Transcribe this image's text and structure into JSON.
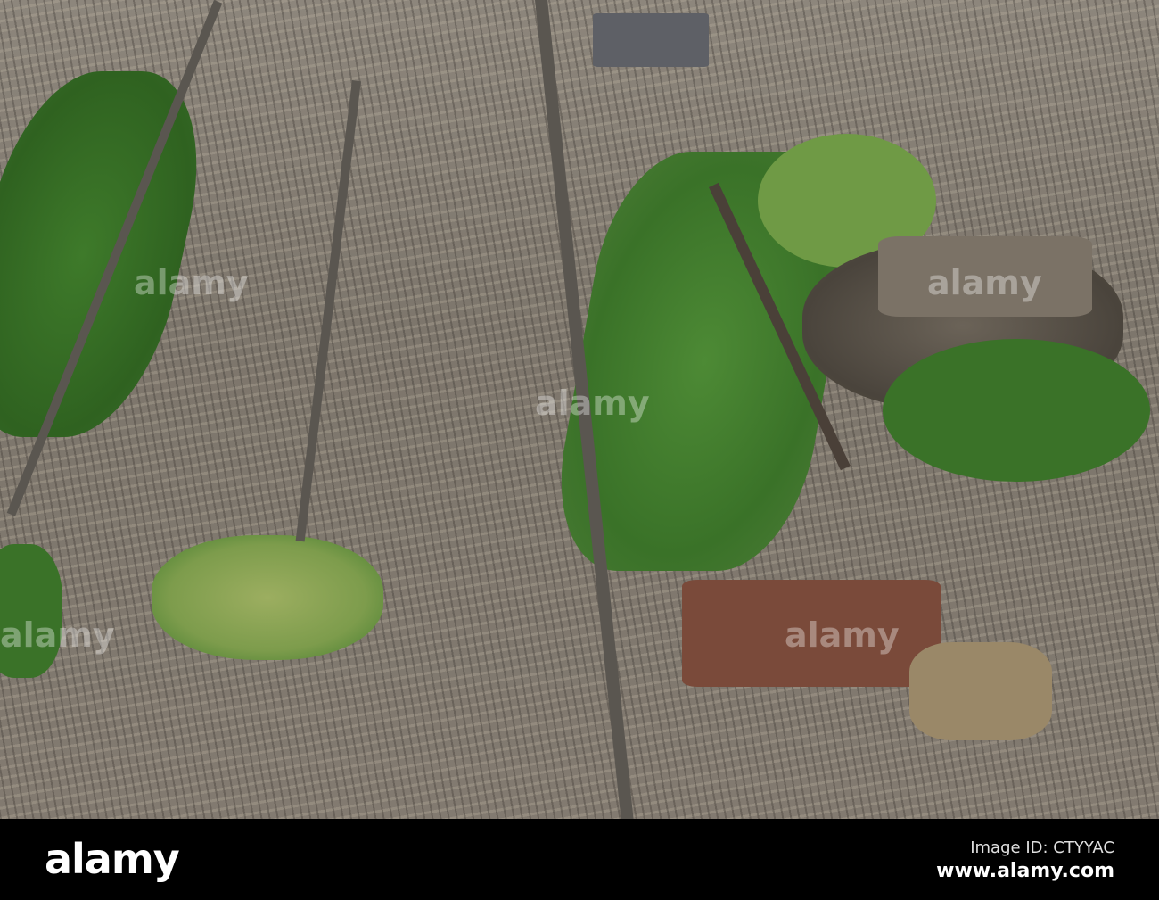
{
  "photo": {
    "subject": "aerial-city-view",
    "watermark_text": "alamy",
    "colors": {
      "park_green": "#3f7a2c",
      "lawn": "#8aa85a",
      "stone": "#8d867c",
      "footer": "#000000"
    }
  },
  "footer": {
    "logo": "alamy",
    "image_id": "Image ID: CTYYAC",
    "website": "www.alamy.com"
  }
}
